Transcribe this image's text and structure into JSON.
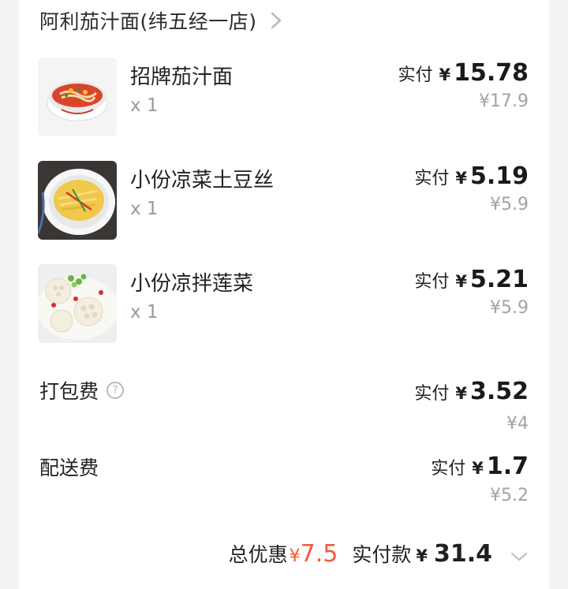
{
  "store": {
    "name": "阿利茄汁面(纬五经一店)",
    "chevron_icon": "chevron-right-icon"
  },
  "items": [
    {
      "name": "招牌茄汁面",
      "qty": "x 1",
      "paid_label": "实付",
      "currency": "¥",
      "paid": "15.78",
      "original": "¥17.9",
      "image": "tomato-noodle-bowl"
    },
    {
      "name": "小份凉菜土豆丝",
      "qty": "x 1",
      "paid_label": "实付",
      "currency": "¥",
      "paid": "5.19",
      "original": "¥5.9",
      "image": "shredded-potato-plate"
    },
    {
      "name": "小份凉拌莲菜",
      "qty": "x 1",
      "paid_label": "实付",
      "currency": "¥",
      "paid": "5.21",
      "original": "¥5.9",
      "image": "lotus-root-plate"
    }
  ],
  "fees": [
    {
      "label": "打包费",
      "has_help": true,
      "help_icon": "question-circle-icon",
      "paid_label": "实付",
      "currency": "¥",
      "paid": "3.52",
      "original": "¥4"
    },
    {
      "label": "配送费",
      "has_help": false,
      "paid_label": "实付",
      "currency": "¥",
      "paid": "1.7",
      "original": "¥5.2"
    }
  ],
  "summary": {
    "discount_label": "总优惠",
    "discount_currency": "¥",
    "discount": "7.5",
    "total_label": "实付款",
    "total_currency": "¥",
    "total": "31.4",
    "expand_icon": "chevron-down-icon"
  },
  "colors": {
    "accent_red": "#ef5b3a",
    "muted_gray": "#a3a3a3",
    "text_dark": "#1f1f1f"
  }
}
